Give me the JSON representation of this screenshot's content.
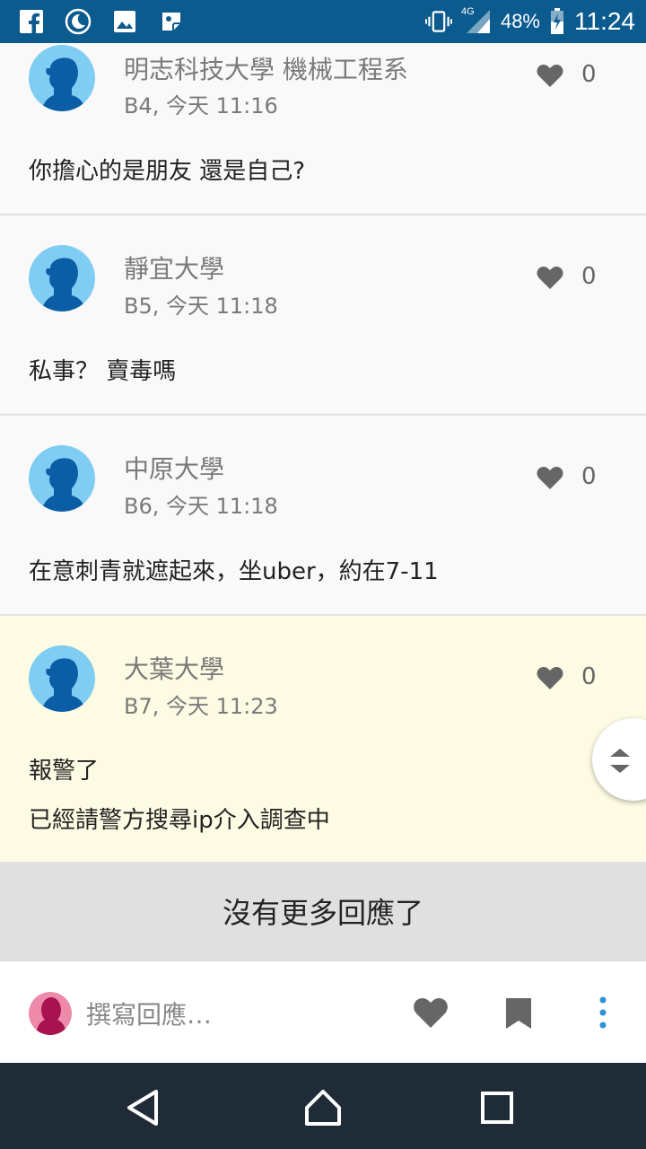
{
  "status_bar": {
    "battery": "48%",
    "time": "11:24",
    "network": "4G",
    "icons": [
      "facebook-icon",
      "night-mode-icon",
      "image-icon",
      "sticker-icon",
      "vibrate-icon",
      "signal-icon",
      "battery-icon"
    ]
  },
  "posts": [
    {
      "author": "明志科技大學 機械工程系",
      "meta": "B4, 今天 11:16",
      "likes": "0",
      "lines": [
        "你擔心的是朋友 還是自己?"
      ]
    },
    {
      "author": "靜宜大學",
      "meta": "B5, 今天 11:18",
      "likes": "0",
      "lines": [
        "私事？ 賣毒嗎"
      ]
    },
    {
      "author": "中原大學",
      "meta": "B6, 今天 11:18",
      "likes": "0",
      "lines": [
        "在意刺青就遮起來，坐uber，約在7-11"
      ]
    },
    {
      "author": "大葉大學",
      "meta": "B7, 今天 11:23",
      "likes": "0",
      "lines": [
        "報警了",
        "已經請警方搜尋ip介入調查中"
      ]
    }
  ],
  "footer": {
    "no_more": "沒有更多回應了"
  },
  "reply_bar": {
    "placeholder": "撰寫回應…"
  },
  "colors": {
    "status_bar": "#0c5b8f",
    "avatar": "#7fcdf2",
    "highlight": "#fdfbe3",
    "nav_bar": "#1f2b37"
  }
}
